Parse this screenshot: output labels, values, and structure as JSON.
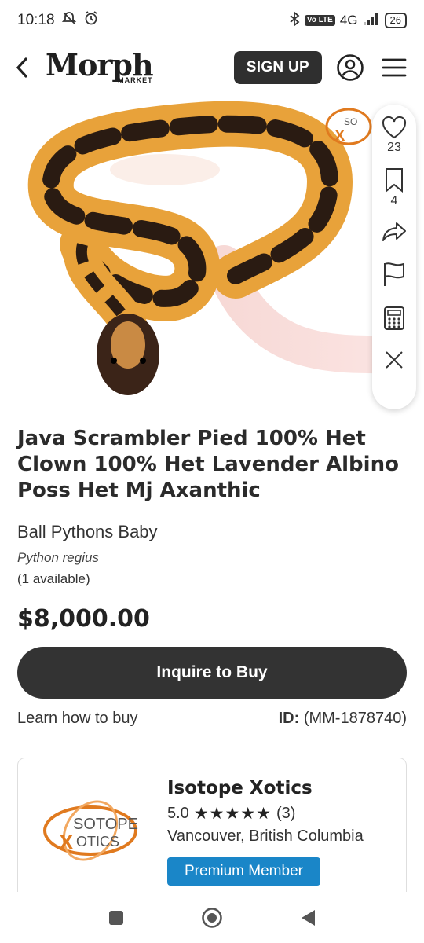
{
  "status_bar": {
    "time": "10:18",
    "network": "4G",
    "volte": "Vo LTE",
    "battery": "26"
  },
  "header": {
    "logo_text": "Morph",
    "logo_subtext": "MARKET",
    "signup_label": "SIGN UP"
  },
  "listing": {
    "title": "Java Scrambler Pied 100% Het Clown 100% Het Lavender Albino Poss Het Mj Axanthic",
    "category": "Ball Pythons Baby",
    "scientific_name": "Python regius",
    "availability": "(1 available)",
    "price": "$8,000.00",
    "inquire_label": "Inquire to Buy",
    "learn_label": "Learn how to buy",
    "id_label": "ID:",
    "id_value": "(MM-1878740)"
  },
  "actions": {
    "likes": "23",
    "saves": "4"
  },
  "seller": {
    "name": "Isotope Xotics",
    "rating": "5.0",
    "stars": "★★★★★",
    "review_count": "(3)",
    "location": "Vancouver, British Columbia",
    "badge": "Premium Member",
    "logo_text_top": "SOTOPE",
    "logo_text_bottom": "OTICS"
  },
  "colors": {
    "primary_dark": "#333333",
    "premium_blue": "#1a86c8",
    "snake_orange": "#e8a23a"
  }
}
